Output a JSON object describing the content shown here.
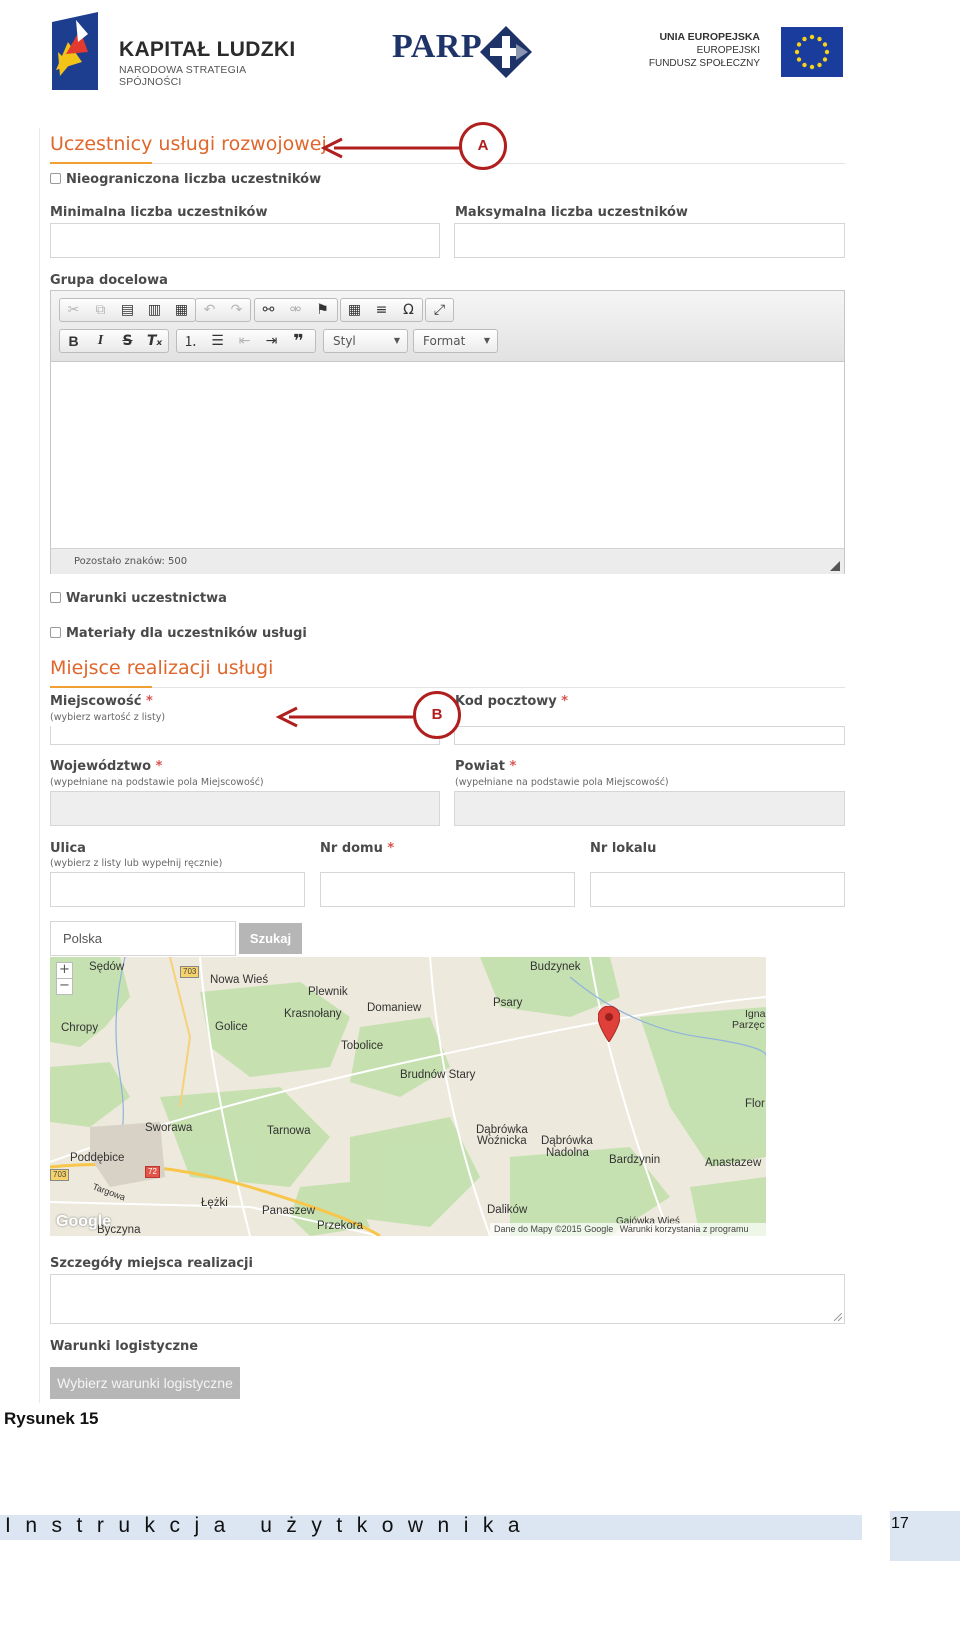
{
  "header": {
    "kapital_ludzki": {
      "title": "KAPITAŁ LUDZKI",
      "subtitle": "NARODOWA STRATEGIA SPÓJNOŚCI"
    },
    "parp": {
      "title": "PARP"
    },
    "eu": {
      "line1": "UNIA EUROPEJSKA",
      "line2": "EUROPEJSKI",
      "line3": "FUNDUSZ SPOŁECZNY"
    }
  },
  "participants": {
    "title": "Uczestnicy usługi rozwojowej",
    "callout": "A",
    "unlimited_label": "Nieograniczona liczba uczestników",
    "min_label": "Minimalna liczba uczestników",
    "max_label": "Maksymalna liczba uczestników",
    "target_group_label": "Grupa docelowa",
    "editor": {
      "style_combo": "Styl",
      "format_combo": "Format",
      "remaining_chars": "Pozostało znaków: 500"
    },
    "conditions_label": "Warunki uczestnictwa",
    "materials_label": "Materiały dla uczestników usługi"
  },
  "location": {
    "title": "Miejsce realizacji usługi",
    "callout": "B",
    "city_label": "Miejscowość",
    "city_hint": "(wybierz wartość z listy)",
    "postcode_label": "Kod pocztowy",
    "voivodeship_label": "Województwo",
    "voivodeship_hint": "(wypełniane na podstawie pola Miejscowość)",
    "county_label": "Powiat",
    "county_hint": "(wypełniane na podstawie pola Miejscowość)",
    "street_label": "Ulica",
    "street_hint": "(wybierz z listy lub wypełnij ręcznie)",
    "house_label": "Nr domu",
    "apartment_label": "Nr lokalu",
    "required_mark": "*",
    "search_value": "Polska",
    "search_button": "Szukaj",
    "map": {
      "zoom_in": "+",
      "zoom_out": "−",
      "places": [
        "Sędów",
        "Nowa Wieś",
        "Plewnik",
        "Krasnołany",
        "Domaniew",
        "Budzynek",
        "Psary",
        "Chropy",
        "Golice",
        "Tobolice",
        "Brudnów Stary",
        "Igna",
        "Parzęc",
        "Flor",
        "Sworawa",
        "Tarnowa",
        "Dąbrówka",
        "Woźnicka",
        "Dąbrówka",
        "Nadolna",
        "Bardzynin",
        "Anastazew",
        "Poddębice",
        "Targowa",
        "Łężki",
        "Panaszew",
        "Przekora",
        "Byczyna",
        "Dalików",
        "Gajówka Wieś"
      ],
      "roads": [
        "703",
        "703",
        "72"
      ],
      "google_logo": "Google",
      "copyright": "Dane do Mapy ©2015 Google",
      "terms": "Warunki korzystania z programu"
    },
    "details_label": "Szczegóły miejsca realizacji",
    "logistics_label": "Warunki logistyczne",
    "logistics_button": "Wybierz warunki logistyczne"
  },
  "caption": "Rysunek 15",
  "footer": {
    "text": "Instrukcja użytkownika",
    "page": "17"
  },
  "colors": {
    "accent": "#e0662b",
    "callout": "#b01e1e",
    "footer_bar": "#dce6f2"
  }
}
